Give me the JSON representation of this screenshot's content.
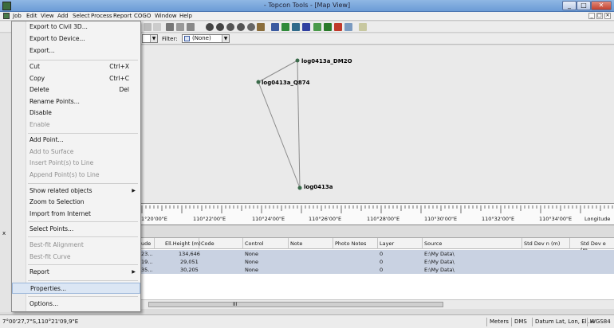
{
  "window": {
    "title": "- Topcon Tools - [Map View]",
    "min": "_",
    "max": "□",
    "close": "✕"
  },
  "menubar": [
    "Job",
    "Edit",
    "View",
    "Add",
    "Select",
    "Process",
    "Report",
    "COGO",
    "Window",
    "Help"
  ],
  "mdi": [
    "_",
    "□",
    "✕"
  ],
  "filter": {
    "label": "Filter:",
    "value": "(None)"
  },
  "map": {
    "points": [
      {
        "label": "log0413a_DM2O"
      },
      {
        "label": "log0413a_Q874"
      },
      {
        "label": "log0413a"
      }
    ]
  },
  "ruler": {
    "ticks": [
      "1°20'00\"E",
      "110°22'00\"E",
      "110°24'00\"E",
      "110°26'00\"E",
      "110°28'00\"E",
      "110°30'00\"E",
      "110°32'00\"E",
      "110°34'00\"E"
    ],
    "axis_label": "Longitude"
  },
  "job_menu": {
    "items": [
      {
        "label": "Export to Civil 3D...",
        "shortcut": "",
        "disabled": false
      },
      {
        "label": "Export to Device...",
        "shortcut": "",
        "disabled": false
      },
      {
        "label": "Export...",
        "shortcut": "",
        "disabled": false
      },
      {
        "label": "Cut",
        "shortcut": "Ctrl+X",
        "disabled": false
      },
      {
        "label": "Copy",
        "shortcut": "Ctrl+C",
        "disabled": false
      },
      {
        "label": "Delete",
        "shortcut": "Del",
        "disabled": false
      },
      {
        "label": "Rename Points...",
        "shortcut": "",
        "disabled": false
      },
      {
        "label": "Disable",
        "shortcut": "",
        "disabled": false
      },
      {
        "label": "Enable",
        "shortcut": "",
        "disabled": true
      },
      {
        "label": "Add Point...",
        "shortcut": "",
        "disabled": false
      },
      {
        "label": "Add to Surface",
        "shortcut": "",
        "disabled": true
      },
      {
        "label": "Insert Point(s) to Line",
        "shortcut": "",
        "disabled": true
      },
      {
        "label": "Append Point(s) to Line",
        "shortcut": "",
        "disabled": true
      },
      {
        "label": "Show related objects",
        "shortcut": "",
        "disabled": false
      },
      {
        "label": "Zoom to Selection",
        "shortcut": "",
        "disabled": false
      },
      {
        "label": "Import from Internet",
        "shortcut": "",
        "disabled": false
      },
      {
        "label": "Select Points...",
        "shortcut": "",
        "disabled": false
      },
      {
        "label": "Best-fit Alignment",
        "shortcut": "",
        "disabled": true
      },
      {
        "label": "Best-fit Curve",
        "shortcut": "",
        "disabled": true
      },
      {
        "label": "Report",
        "shortcut": "",
        "disabled": false
      },
      {
        "label": "Properties...",
        "shortcut": "",
        "disabled": false
      },
      {
        "label": "Options...",
        "shortcut": "",
        "disabled": false
      }
    ]
  },
  "table": {
    "columns": [
      "ude",
      "Ell.Height (m)",
      "Code",
      "Control",
      "Note",
      "Photo Notes",
      "Layer",
      "Source",
      "Std Dev n (m)",
      "Std Dev e (m"
    ],
    "rows": [
      [
        "23...",
        "134,646",
        "",
        "None",
        "",
        "",
        "0",
        "E:\\My Data\\",
        "",
        ""
      ],
      [
        "19...",
        "29,051",
        "",
        "None",
        "",
        "",
        "0",
        "E:\\My Data\\",
        "",
        ""
      ],
      [
        "35...",
        "30,205",
        "",
        "None",
        "",
        "",
        "0",
        "E:\\My Data\\",
        "",
        ""
      ]
    ],
    "scroll_grip": "III"
  },
  "statusbar": {
    "coords": "7°00'27,7\"S,110°21'09,9\"E",
    "units": "Meters",
    "angle": "DMS",
    "datum": "Datum Lat, Lon, Ell.H",
    "ellipsoid": "WGS84"
  },
  "colors": {
    "titlebar": "#7aa6dd",
    "map_bg": "#eaeaea",
    "selected_row": "#c9d2e2",
    "line": "#8c8c8c"
  }
}
